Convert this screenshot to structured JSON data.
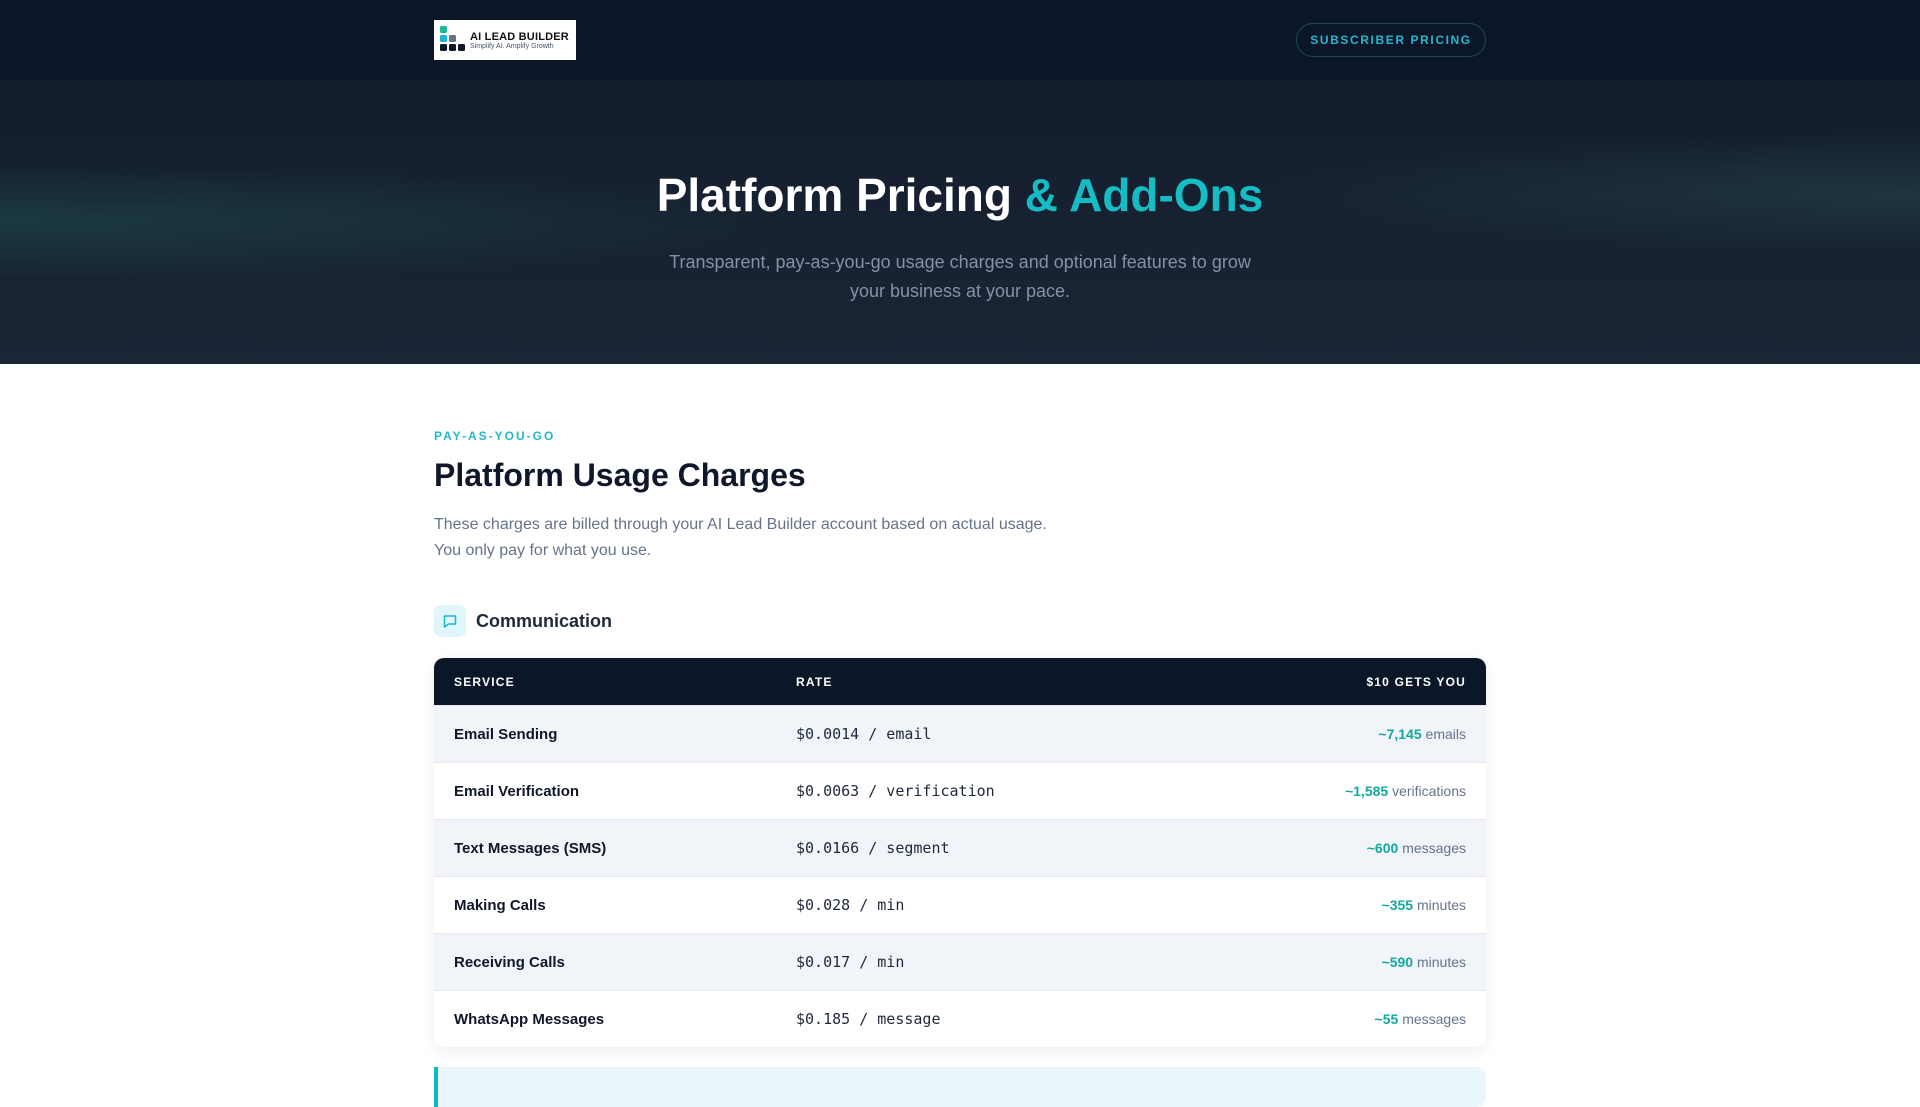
{
  "nav": {
    "logo_title": "AI LEAD BUILDER",
    "logo_tagline": "Simplify AI. Amplify Growth",
    "button": "SUBSCRIBER PRICING"
  },
  "hero": {
    "title_main": "Platform Pricing",
    "title_accent": "& Add-Ons",
    "subtitle": "Transparent, pay-as-you-go usage charges and optional features to grow your business at your pace."
  },
  "section": {
    "eyebrow": "PAY-AS-YOU-GO",
    "title": "Platform Usage Charges",
    "desc_line1": "These charges are billed through your AI Lead Builder account based on actual usage.",
    "desc_line2": "You only pay for what you use."
  },
  "category": {
    "name": "Communication",
    "icon": "chat-icon"
  },
  "table": {
    "headers": [
      "SERVICE",
      "RATE",
      "$10 GETS YOU"
    ],
    "rows": [
      {
        "service": "Email Sending",
        "rate": "$0.0014 / email",
        "qty": "~7,145",
        "unit": "emails"
      },
      {
        "service": "Email Verification",
        "rate": "$0.0063 / verification",
        "qty": "~1,585",
        "unit": "verifications"
      },
      {
        "service": "Text Messages (SMS)",
        "rate": "$0.0166 / segment",
        "qty": "~600",
        "unit": "messages"
      },
      {
        "service": "Making Calls",
        "rate": "$0.028 / min",
        "qty": "~355",
        "unit": "minutes"
      },
      {
        "service": "Receiving Calls",
        "rate": "$0.017 / min",
        "qty": "~590",
        "unit": "minutes"
      },
      {
        "service": "WhatsApp Messages",
        "rate": "$0.185 / message",
        "qty": "~55",
        "unit": "messages"
      }
    ]
  },
  "colors": {
    "accent": "#16bcc4",
    "nav_bg": "#0b1628",
    "qty": "#13a89e"
  }
}
